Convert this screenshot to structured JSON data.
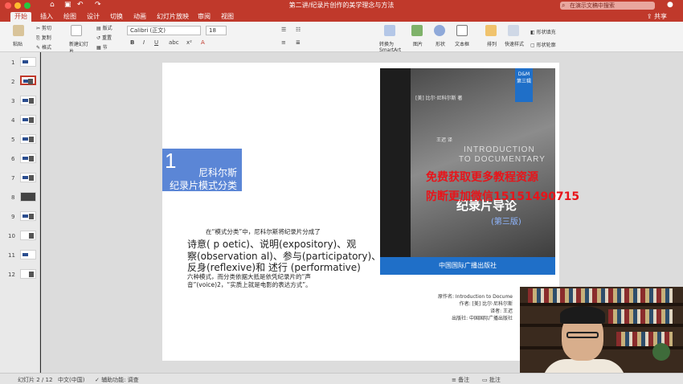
{
  "window": {
    "title": "第二讲/纪录片创作的美学理念与方法",
    "search_placeholder": "在演示文稿中搜索",
    "share_label": "共享"
  },
  "tabs": [
    "开始",
    "插入",
    "绘图",
    "设计",
    "切换",
    "动画",
    "幻灯片放映",
    "审阅",
    "视图"
  ],
  "ribbon": {
    "paste": "粘贴",
    "cut": "剪切",
    "copy": "复制",
    "format": "格式",
    "new_slide": "新建幻灯片",
    "layout": "版式",
    "reset": "重置",
    "section": "节",
    "font_name": "Calibri (正文)",
    "font_size": "18",
    "smartart": "转换为SmartArt",
    "picture": "图片",
    "shape": "形状",
    "textbox": "文本框",
    "arrange": "排列",
    "quick_style": "快速样式",
    "shape_fill": "形状填充",
    "shape_outline": "形状轮廓"
  },
  "slides_panel": {
    "numbers": [
      "1",
      "2",
      "3",
      "4",
      "5",
      "6",
      "7",
      "8",
      "9",
      "10",
      "11",
      "12"
    ],
    "selected": "2"
  },
  "slide": {
    "section_number": "1",
    "section_title_line1": "尼科尔斯",
    "section_title_line2": "纪录片模式分类",
    "intro": "在“模式分类”中，尼科尔斯将纪录片分成了",
    "big_line1": "诗意( p oetic)、说明(expository)、观",
    "big_line2": "察(observation al)、参与(participatory)、",
    "big_line3": "反身(reflexive)和 述行 (performative)",
    "tail_line1": "六种模式，而分类依据大抵是依凭纪录片的“声",
    "tail_line2": "音”(voice)2，“实质上就是电影的表达方式”。",
    "book": {
      "dm_label": "D&M",
      "dm_sub": "第三辑",
      "author": "[美] 比尔·尼科尔斯 著",
      "translator": "王迟 译",
      "title_en_line1": "INTRODUCTION",
      "title_en_line2": "TO DOCUMENTARY",
      "title_cn": "纪录片导论",
      "edition": "(第三版)",
      "publisher_band": "中国国际广播出版社"
    },
    "meta": {
      "line1": "原作名: Introduction to Docume",
      "line2": "作者: [美] 比尔·尼科尔斯",
      "line3": "译者: 王迟",
      "line4": "出版社: 中国国际广播出版社"
    }
  },
  "watermark": {
    "line1": "免费获取更多教程资源",
    "line2": "防断更加微信15151490715"
  },
  "statusbar": {
    "slide_count": "幻灯片 2 / 12",
    "language": "中文(中国)",
    "accessibility": "辅助功能: 调查",
    "notes": "备注",
    "comments": "批注"
  },
  "colors": {
    "accent": "#c0392b",
    "section_block": "#5b86d6",
    "book_band": "#1f6fc8",
    "watermark": "#e8141a"
  }
}
